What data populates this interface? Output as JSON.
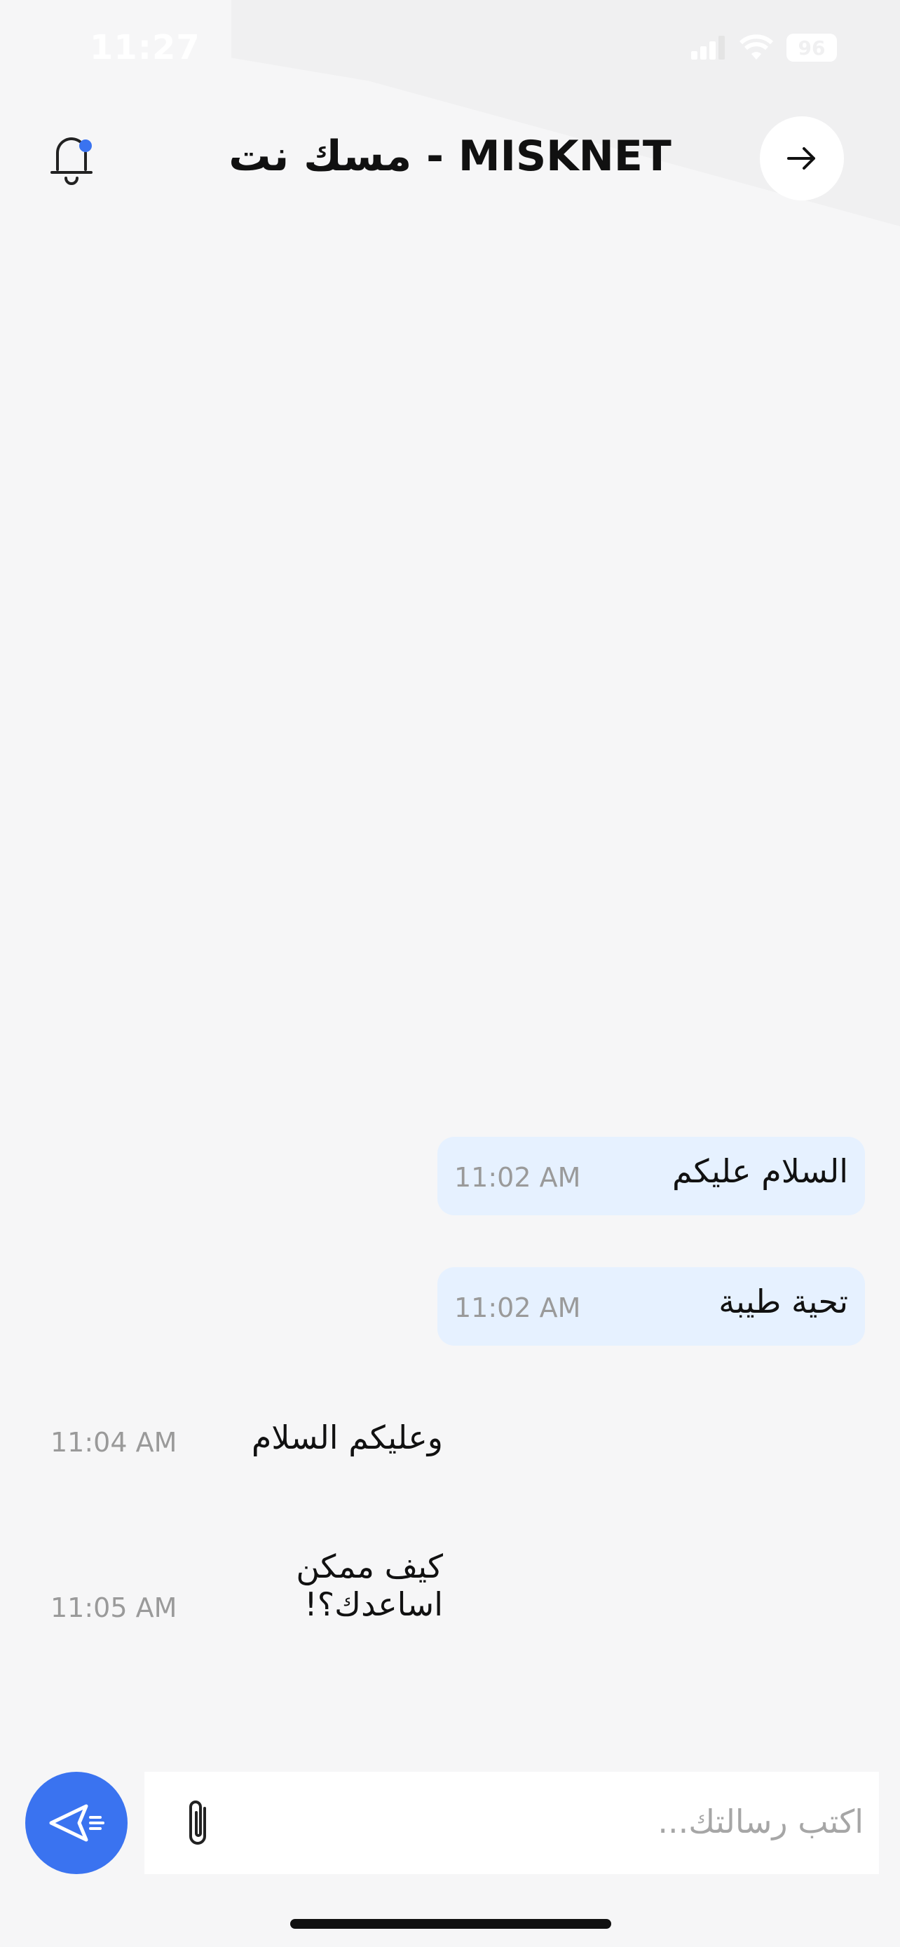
{
  "status_bar": {
    "time": "11:27",
    "battery": "96"
  },
  "header": {
    "title": "مسك نت - MISKNET"
  },
  "messages": [
    {
      "text": "السلام عليكم",
      "time": "11:02 AM"
    },
    {
      "text": "تحية طيبة",
      "time": "11:02 AM"
    },
    {
      "text": "وعليكم السلام",
      "time": "11:04 AM"
    },
    {
      "text_line1": "كيف ممكن",
      "text_line2": "اساعدك؟!",
      "time": "11:05 AM"
    }
  ],
  "composer": {
    "placeholder": "اكتب رسالتك..."
  },
  "colors": {
    "accent": "#3a73f0",
    "outgoing_bubble": "#e6f1ff",
    "background": "#f6f6f7"
  }
}
